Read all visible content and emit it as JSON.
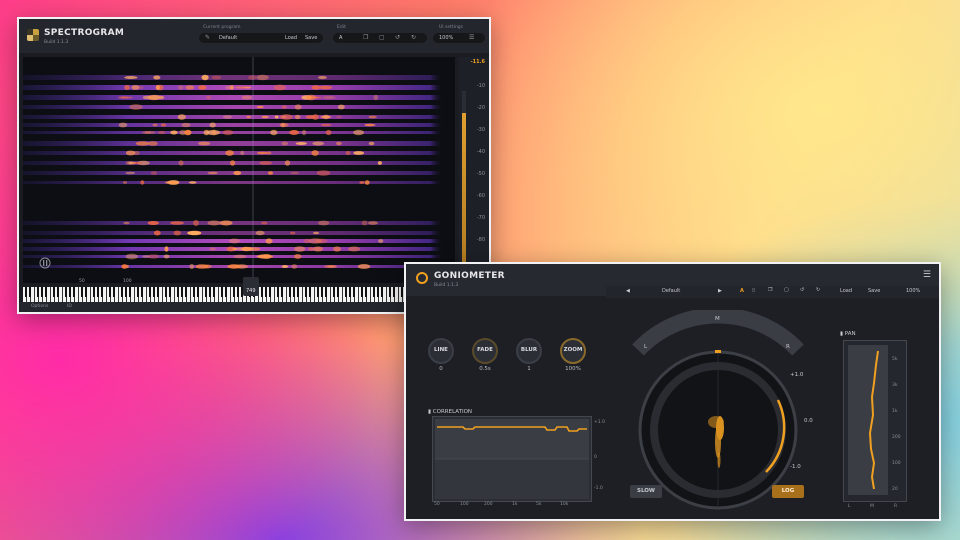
{
  "spectrogram": {
    "title": "SPECTROGRAM",
    "build": "Build 1.1.3",
    "current_program_label": "Current program",
    "program_name": "Default",
    "load_label": "Load",
    "save_label": "Save",
    "edit_label": "Edit",
    "ab_label": "A",
    "ui_settings_label": "UI settings",
    "zoom": "100%",
    "db_top": "-11.6",
    "db_ticks": [
      "-10",
      "-20",
      "-30",
      "-40",
      "-50",
      "-60",
      "-70",
      "-80"
    ],
    "freq_ticks": [
      "50",
      "100",
      "749"
    ],
    "options_label": "Options"
  },
  "goniometer": {
    "title": "GONIOMETER",
    "build": "Build 1.1.3",
    "program_name": "Default",
    "ab_a": "A",
    "ab_b": "B",
    "load_label": "Load",
    "save_label": "Save",
    "zoom": "100%",
    "knobs": [
      {
        "label": "LINE",
        "value": "0"
      },
      {
        "label": "FADE",
        "value": "0.5s"
      },
      {
        "label": "BLUR",
        "value": "1"
      },
      {
        "label": "ZOOM",
        "value": "100%"
      }
    ],
    "scope_labels": {
      "m": "M",
      "l": "L",
      "r": "R"
    },
    "scope_scale": [
      "+1.0",
      "0.0",
      "-1.0"
    ],
    "slow_label": "SLOW",
    "log_label": "LOG",
    "correlation": {
      "title": "CORRELATION",
      "y_ticks": [
        "+1.0",
        "0",
        "-1.0"
      ],
      "x_ticks": [
        "50",
        "100",
        "200",
        "1k",
        "5k",
        "10k"
      ]
    },
    "pan": {
      "title": "PAN",
      "freq_ticks": [
        "5k",
        "3k",
        "1k",
        "200",
        "100",
        "20"
      ],
      "x_ticks": [
        "L",
        "M",
        "R"
      ]
    },
    "accent_color": "#f0a020"
  }
}
